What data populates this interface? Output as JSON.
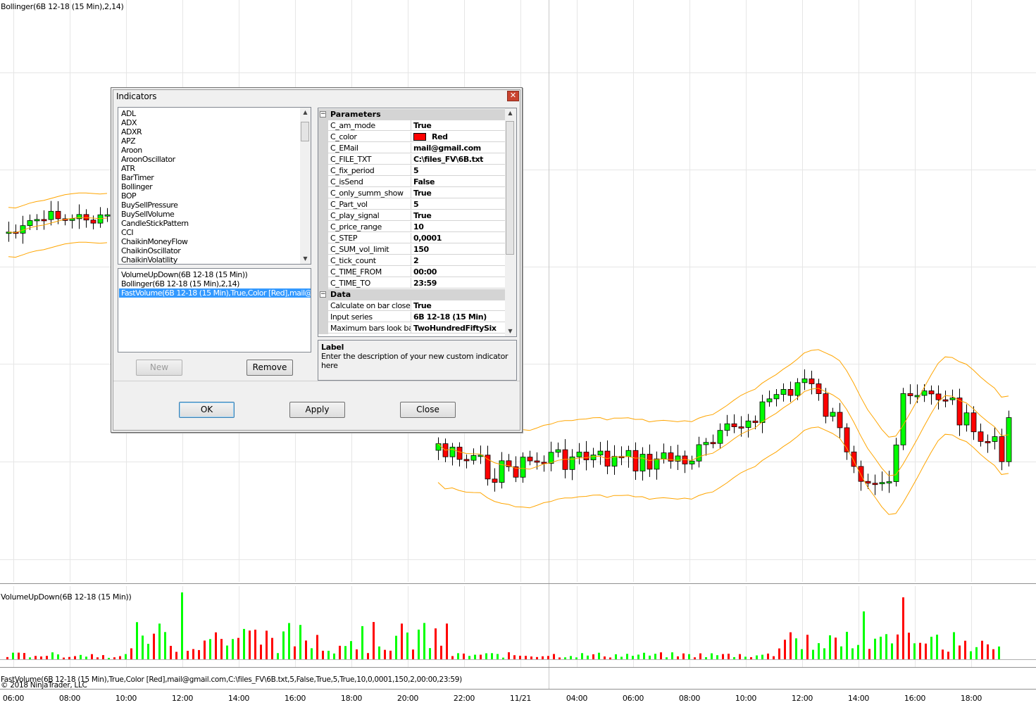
{
  "chart": {
    "price_panel_label": "Bollinger(6B 12-18 (15 Min),2,14)",
    "volume_panel_label": "VolumeUpDown(6B 12-18 (15 Min))",
    "status_label": "FastVolume(6B 12-18 (15 Min),True,Color [Red],mail@gmail.com,C:\\files_FV\\6B.txt,5,False,True,5,True,10,0,0001,150,2,00:00,23:59)",
    "copyright": "© 2018 NinjaTrader, LLC",
    "up_color": "#00ff00",
    "down_color": "#ff0000",
    "band_color": "#ffa500",
    "time_labels": [
      "06:00",
      "08:00",
      "10:00",
      "12:00",
      "14:00",
      "16:00",
      "18:00",
      "20:00",
      "22:00",
      "11/21",
      "04:00",
      "06:00",
      "08:00",
      "10:00",
      "12:00",
      "14:00",
      "16:00",
      "18:00"
    ]
  },
  "dialog": {
    "title": "Indicators",
    "close_icon": "close-icon",
    "indicator_list": [
      "ADL",
      "ADX",
      "ADXR",
      "APZ",
      "Aroon",
      "AroonOscillator",
      "ATR",
      "BarTimer",
      "Bollinger",
      "BOP",
      "BuySellPressure",
      "BuySellVolume",
      "CandleStickPattern",
      "CCI",
      "ChaikinMoneyFlow",
      "ChaikinOscillator",
      "ChaikinVolatility"
    ],
    "applied_list": [
      "VolumeUpDown(6B 12-18 (15 Min))",
      "Bollinger(6B 12-18 (15 Min),2,14)",
      "FastVolume(6B 12-18 (15 Min),True,Color [Red],mail@gm"
    ],
    "selected_applied_index": 2,
    "new_label": "New",
    "remove_label": "Remove",
    "ok_label": "OK",
    "apply_label": "Apply",
    "close_label": "Close",
    "parameters": {
      "category": "Parameters",
      "rows": [
        {
          "name": "C_am_mode",
          "value": "True"
        },
        {
          "name": "C_color",
          "value": "Red",
          "swatch": "#ff0000"
        },
        {
          "name": "C_EMail",
          "value": "mail@gmail.com"
        },
        {
          "name": "C_FILE_TXT",
          "value": "C:\\files_FV\\6B.txt"
        },
        {
          "name": "C_fix_period",
          "value": "5"
        },
        {
          "name": "C_isSend",
          "value": "False"
        },
        {
          "name": "C_only_summ_show",
          "value": "True"
        },
        {
          "name": "C_Part_vol",
          "value": "5"
        },
        {
          "name": "C_play_signal",
          "value": "True"
        },
        {
          "name": "C_price_range",
          "value": "10"
        },
        {
          "name": "C_STEP",
          "value": "0,0001"
        },
        {
          "name": "C_SUM_vol_limit",
          "value": "150"
        },
        {
          "name": "C_tick_count",
          "value": "2"
        },
        {
          "name": "C_TIME_FROM",
          "value": "00:00"
        },
        {
          "name": "C_TIME_TO",
          "value": "23:59"
        }
      ]
    },
    "data_section": {
      "category": "Data",
      "rows": [
        {
          "name": "Calculate on bar close",
          "value": "True"
        },
        {
          "name": "Input series",
          "value": "6B 12-18 (15 Min)"
        },
        {
          "name": "Maximum bars look back",
          "value": "TwoHundredFiftySix"
        }
      ]
    },
    "description": {
      "title": "Label",
      "text": "Enter the description of your new custom indicator here"
    }
  }
}
